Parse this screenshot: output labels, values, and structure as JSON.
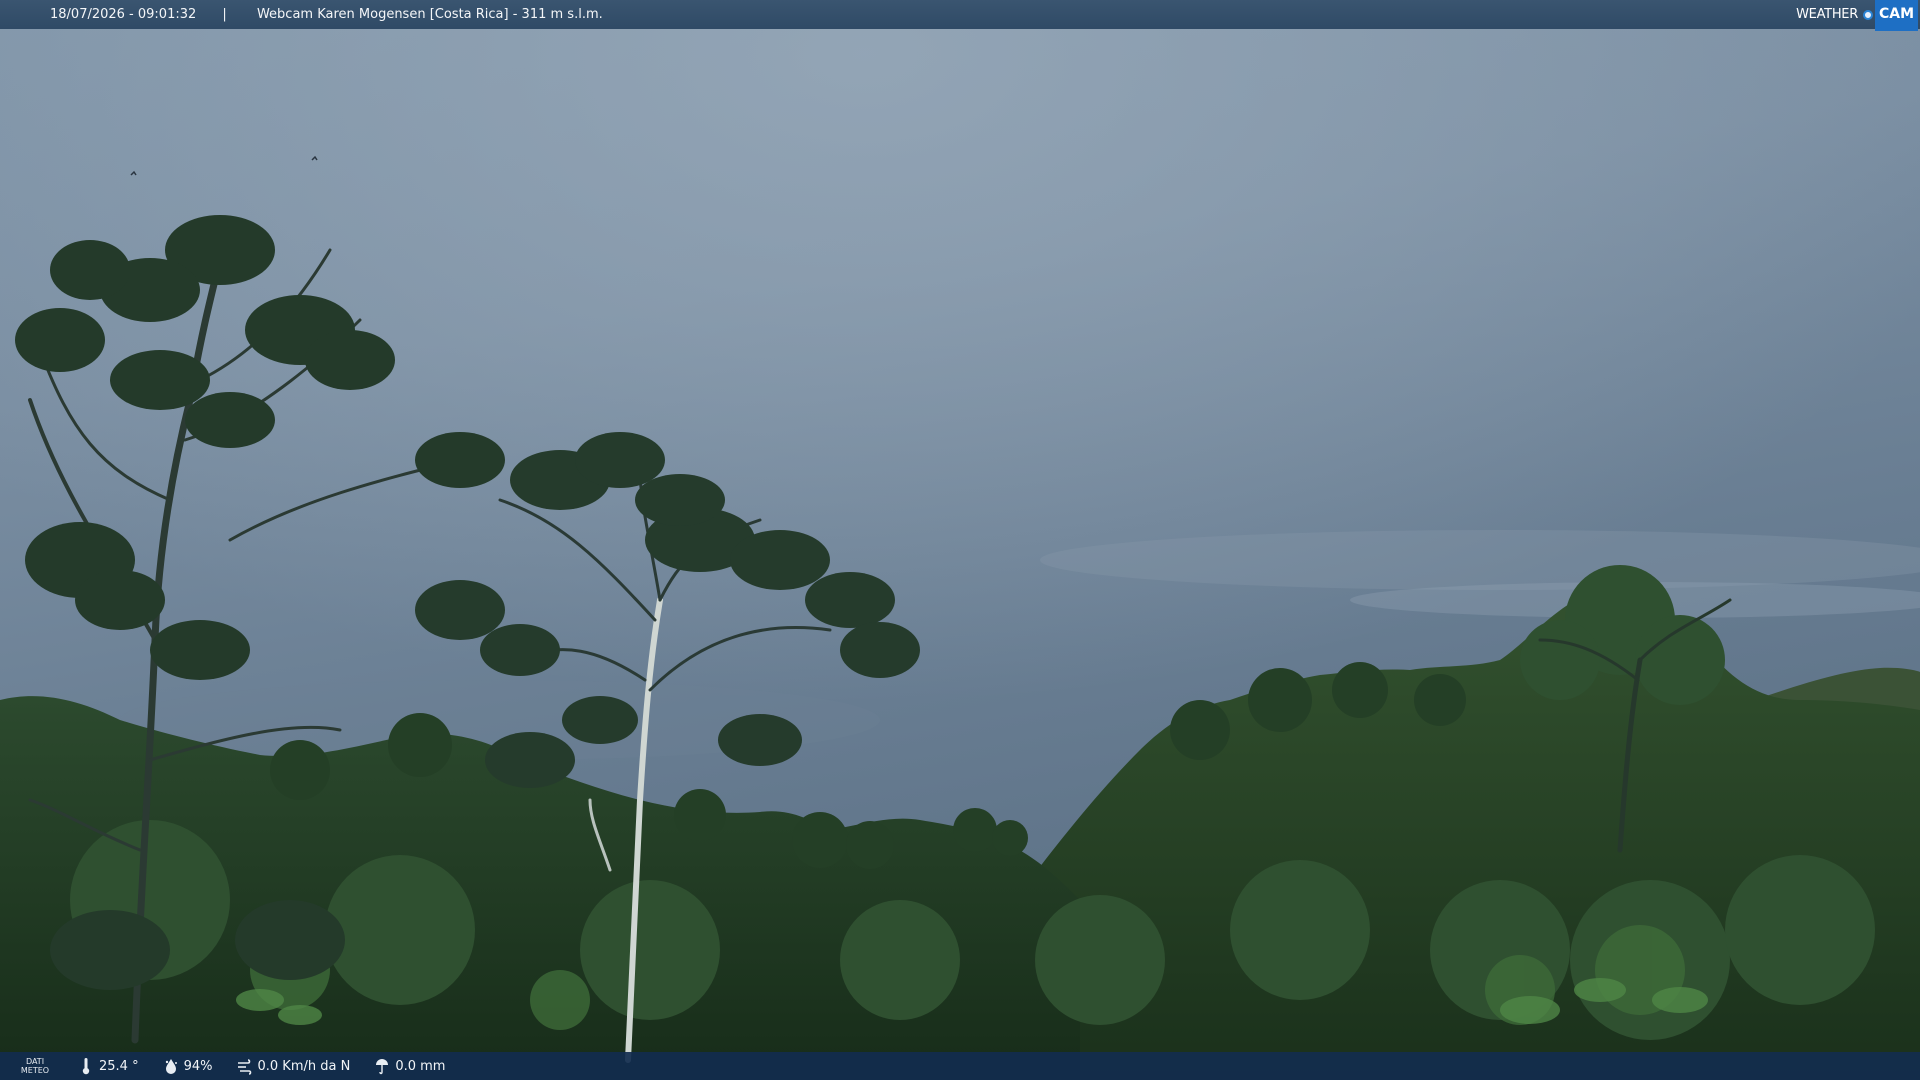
{
  "header": {
    "datetime": "18/07/2026 - 09:01:32",
    "separator": "|",
    "title": "Webcam Karen Mogensen [Costa Rica] - 311 m s.l.m.",
    "logo_weather": "WEATHER",
    "logo_cam": "CAM"
  },
  "footer": {
    "meteo_label_line1": "DATI",
    "meteo_label_line2": "METEO",
    "temperature": "25.4 °",
    "humidity": "94%",
    "wind": "0.0 Km/h da N",
    "rain": "0.0 mm",
    "icons": [
      "thermometer-icon",
      "humidity-icon",
      "wind-icon",
      "rain-icon"
    ]
  },
  "colors": {
    "top_bar": "#34506c",
    "bottom_bar": "#122c4e",
    "logo_accent": "#1e6fc4",
    "sky": "#6f8498",
    "foliage": "#1f3a22"
  }
}
